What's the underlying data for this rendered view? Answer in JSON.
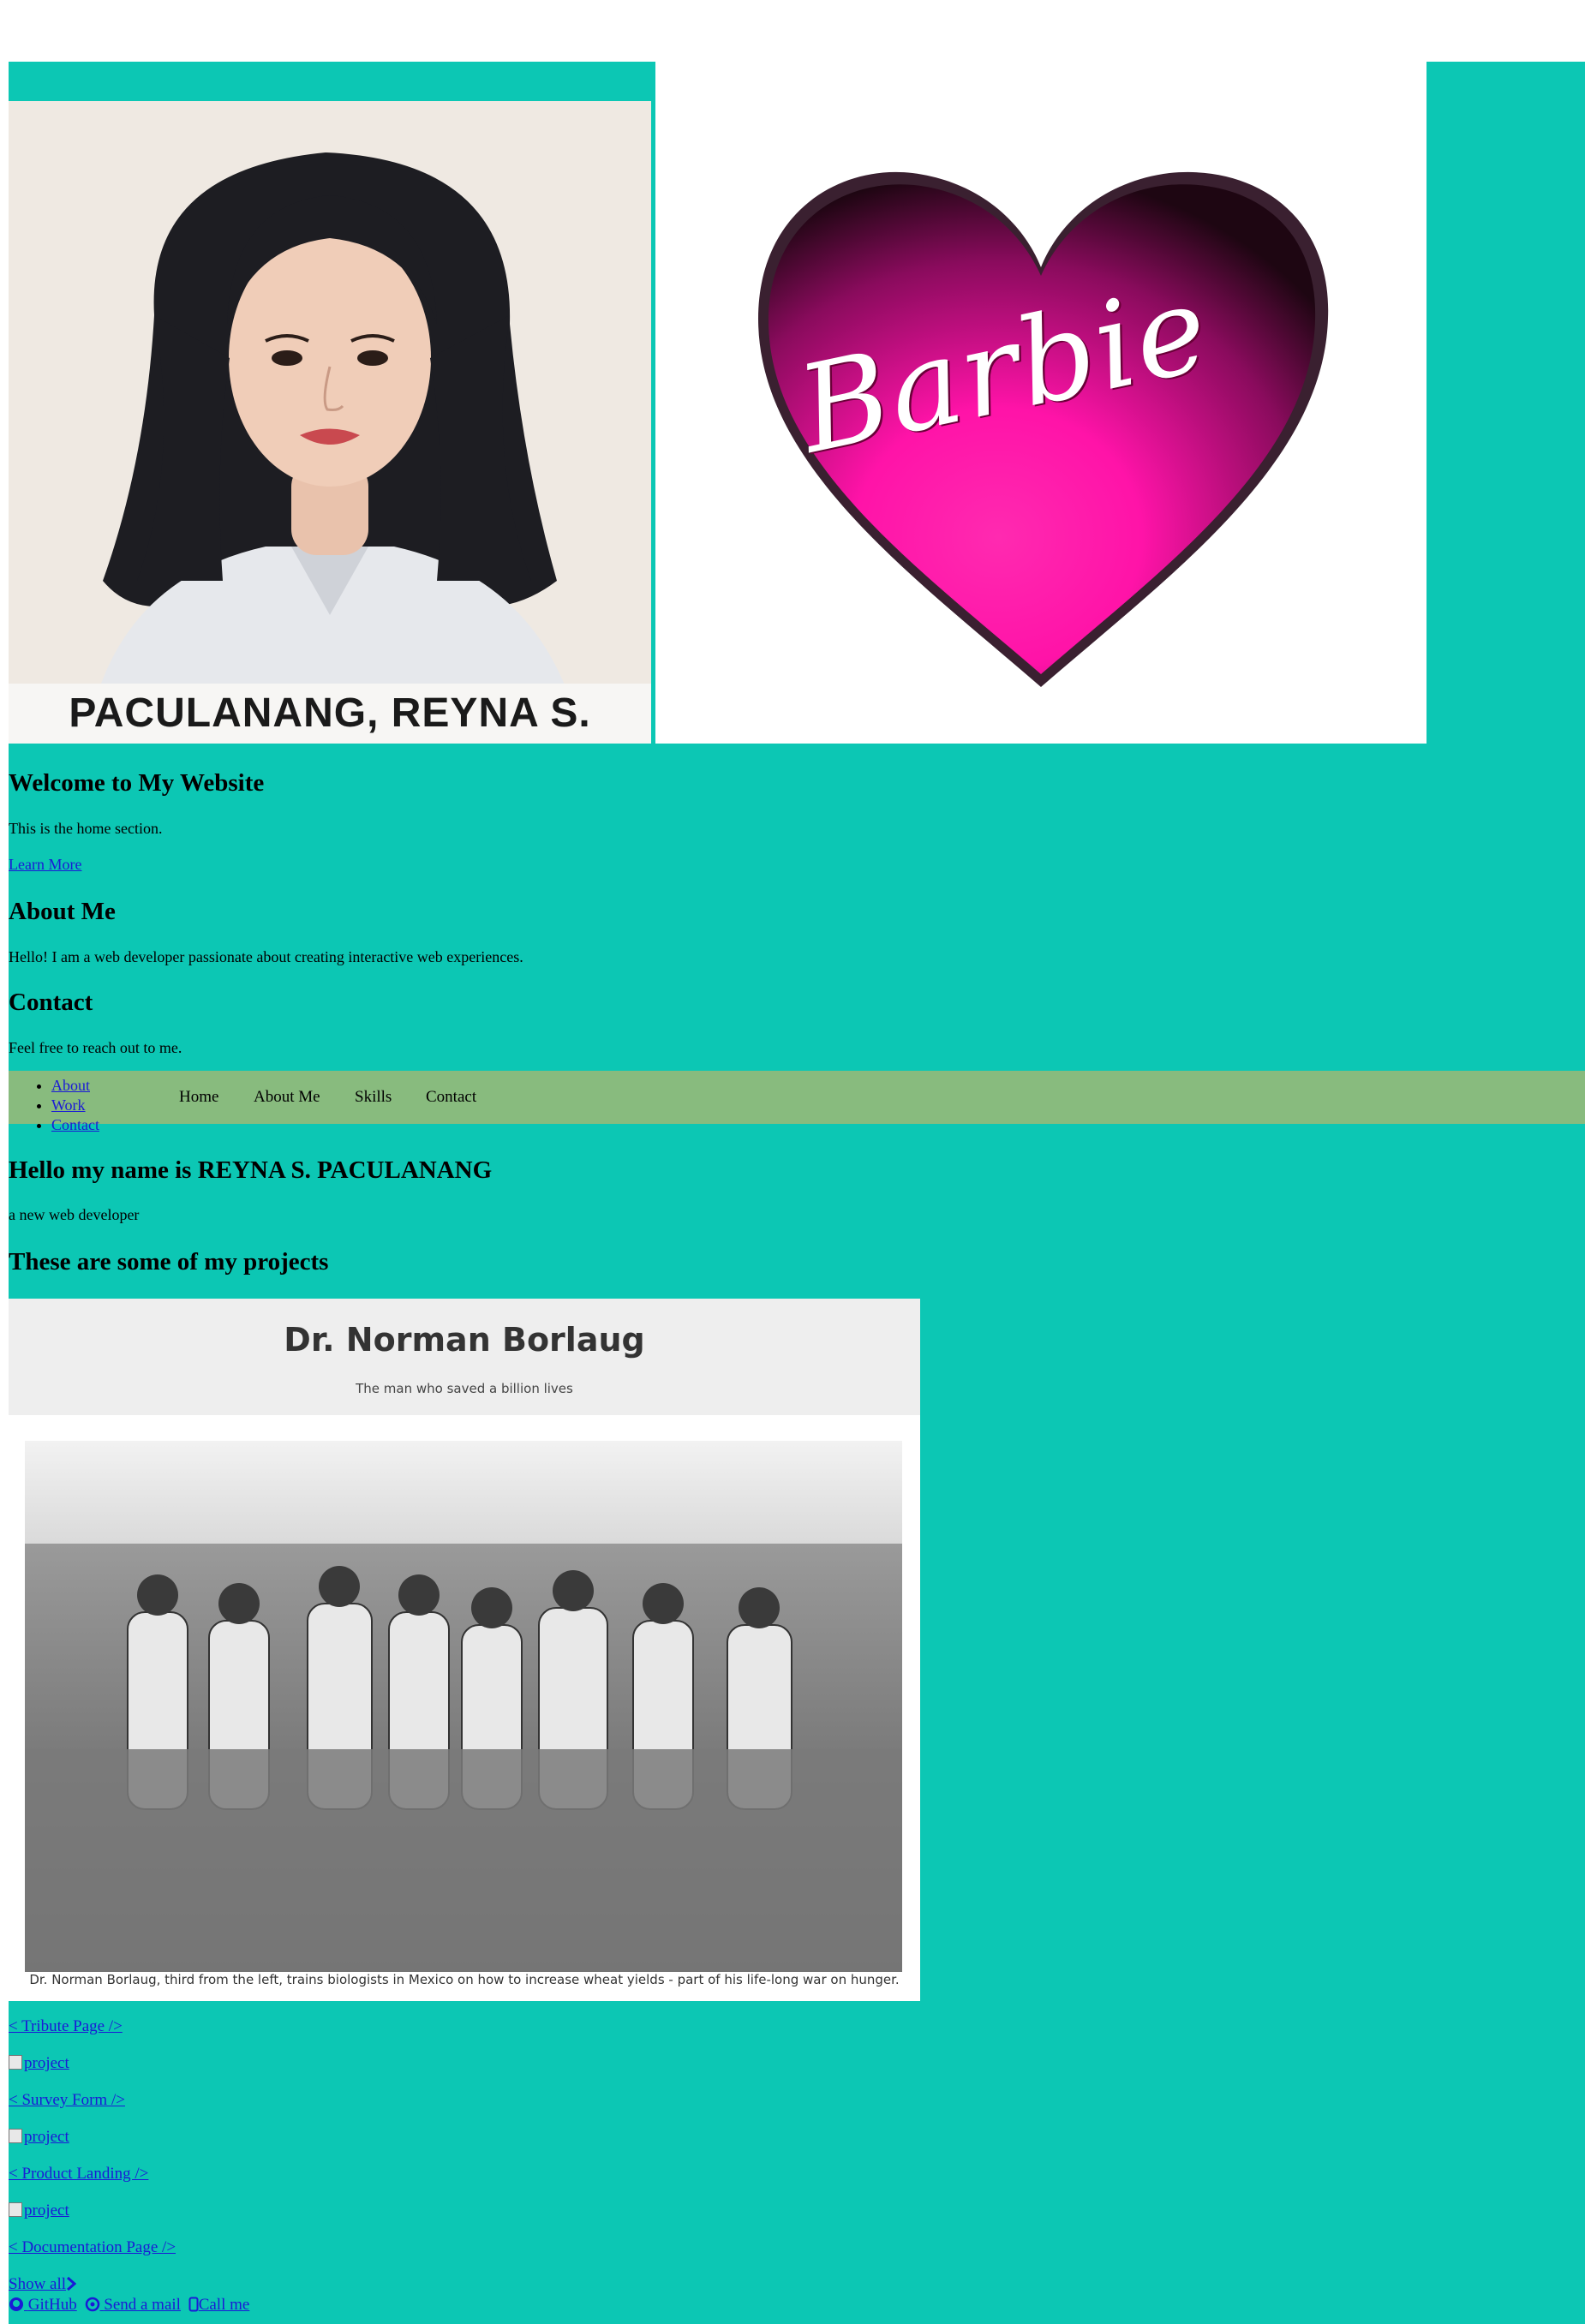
{
  "portrait": {
    "name_caption": "PACULANANG, REYNA S."
  },
  "logo": {
    "text": "Barbie"
  },
  "home": {
    "title": "Welcome to My Website",
    "text": "This is the home section.",
    "link": "Learn More"
  },
  "about": {
    "title": "About Me",
    "text": "Hello! I am a web developer passionate about creating interactive web experiences."
  },
  "contact": {
    "title": "Contact",
    "text": "Feel free to reach out to me."
  },
  "nav": {
    "list_items": [
      "About",
      "Work",
      "Contact"
    ],
    "top_links": [
      "Home",
      "About Me",
      "Skills",
      "Contact"
    ]
  },
  "welcome": {
    "heading": "Hello my name is REYNA S. PACULANANG",
    "subtitle": "a new web developer"
  },
  "projects": {
    "heading": "These are some of my projects",
    "tribute_preview": {
      "title": "Dr. Norman Borlaug",
      "subtitle": "The man who saved a billion lives",
      "caption": "Dr. Norman Borlaug, third from the left, trains biologists in Mexico on how to increase wheat yields - part of his life-long war on hunger."
    },
    "items": [
      {
        "label": "< Tribute Page />"
      },
      {
        "img_alt": "project",
        "label": "< Survey Form />"
      },
      {
        "img_alt": "project",
        "label": "< Product Landing />"
      },
      {
        "img_alt": "project",
        "label": "< Documentation Page />"
      }
    ],
    "show_all": "Show all"
  },
  "footer": {
    "github": "GitHub",
    "mail": "Send a mail",
    "call": "Call me"
  },
  "colors": {
    "page_bg": "#0cc7b4",
    "nav_bg": "#88bb7e",
    "link": "#1a1ad6"
  }
}
